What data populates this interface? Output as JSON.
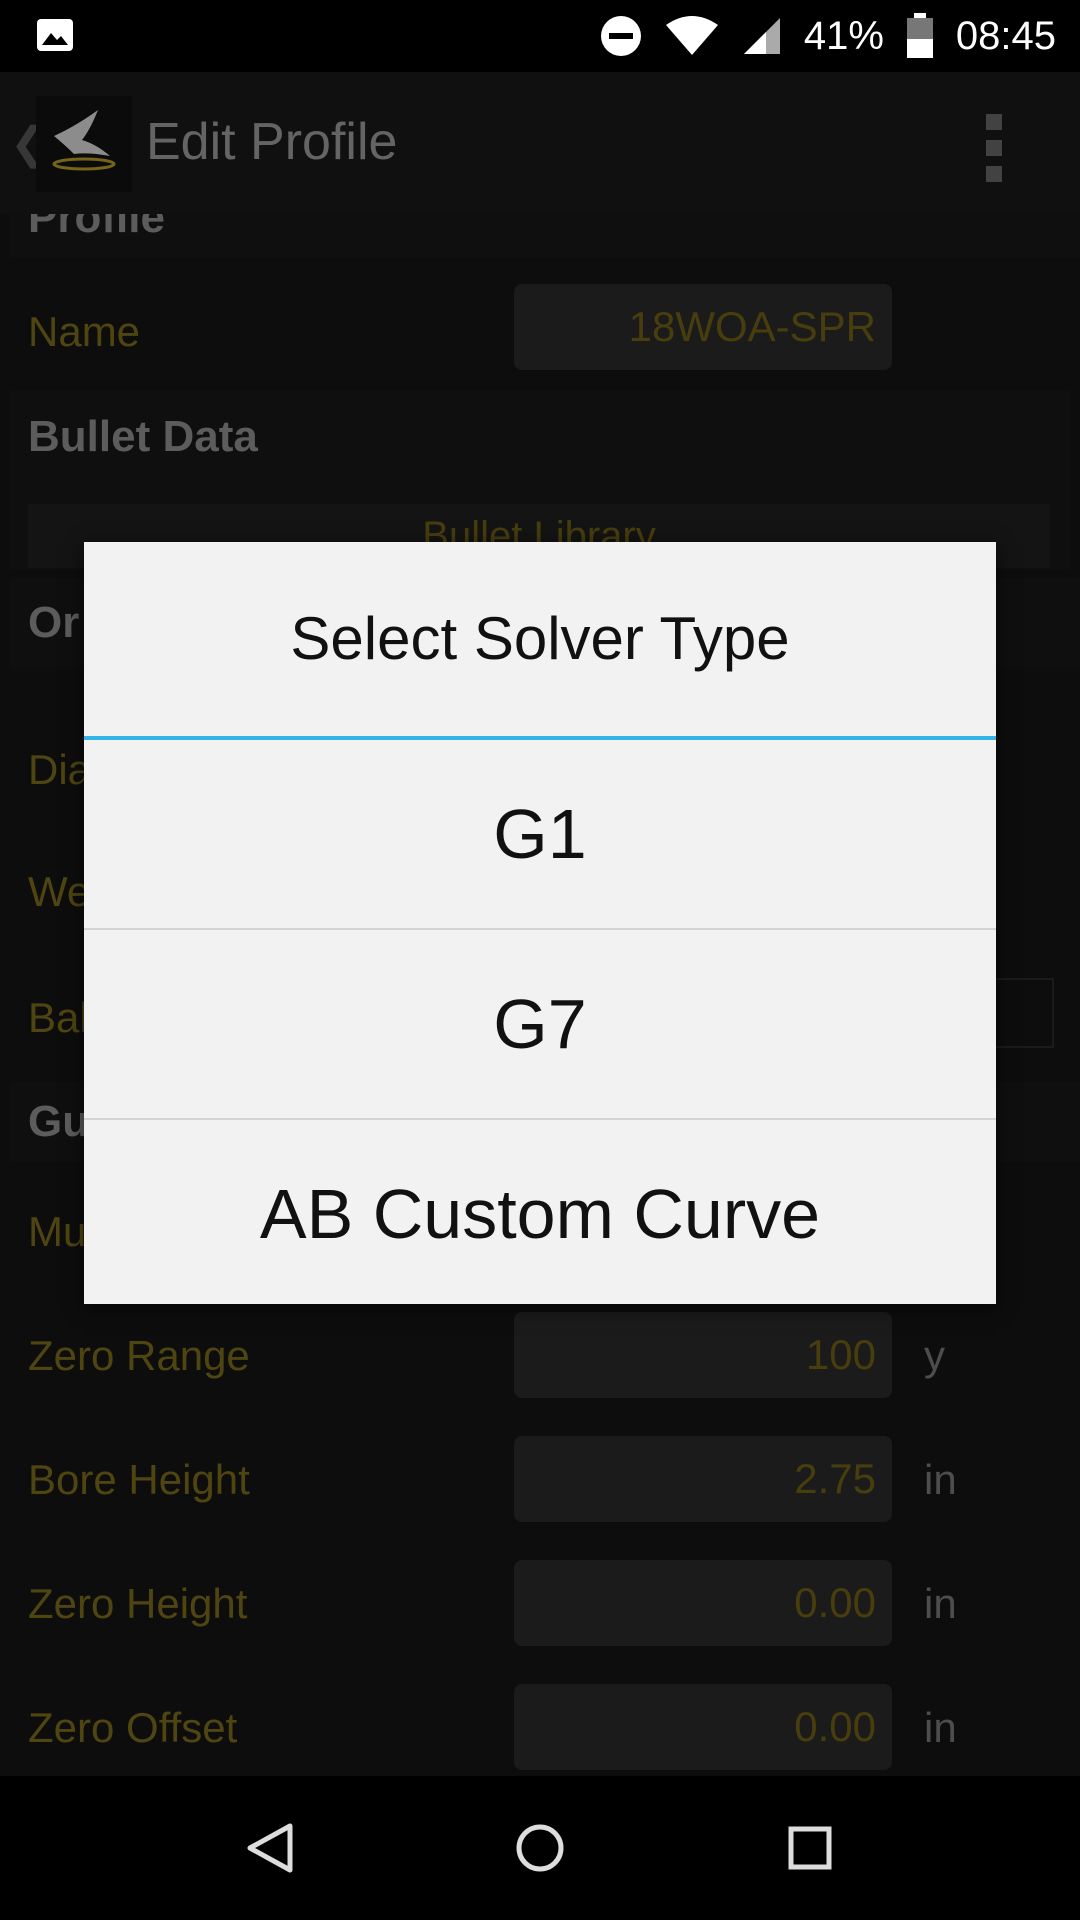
{
  "status_bar": {
    "battery": "41%",
    "time": "08:45",
    "icons": [
      "image-icon",
      "dnd-icon",
      "wifi-icon",
      "signal-icon",
      "battery-icon"
    ]
  },
  "app_bar": {
    "title": "Edit Profile"
  },
  "profile_section": {
    "header": "Profile",
    "name_label": "Name",
    "name_value": "18WOA-SPR"
  },
  "bullet_section": {
    "header": "Bullet Data",
    "library_button": "Bullet Library",
    "partial_labels": {
      "or": "Or",
      "dia": "Dia",
      "we": "We",
      "bal": "Bal",
      "gu": "Gu",
      "mu": "Mu"
    }
  },
  "gun_rows": [
    {
      "label": "Zero Range",
      "value": "100",
      "unit": "y"
    },
    {
      "label": "Bore Height",
      "value": "2.75",
      "unit": "in"
    },
    {
      "label": "Zero Height",
      "value": "0.00",
      "unit": "in"
    },
    {
      "label": "Zero Offset",
      "value": "0.00",
      "unit": "in"
    }
  ],
  "dialog": {
    "title": "Select Solver Type",
    "options": [
      "G1",
      "G7",
      "AB Custom Curve"
    ]
  },
  "colors": {
    "accent": "#33b5e5",
    "label_gold": "#7a6a1a",
    "dialog_bg": "#f2f2f2"
  }
}
